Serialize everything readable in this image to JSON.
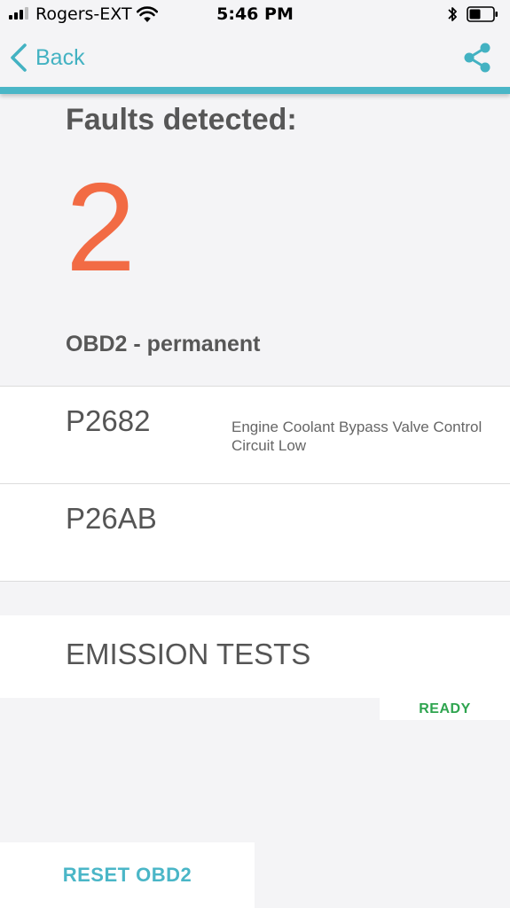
{
  "status_bar": {
    "carrier": "Rogers-EXT",
    "time": "5:46 PM",
    "signal_bars_filled": 3,
    "signal_bars_total": 4,
    "icons": [
      "signal-icon",
      "wifi-icon",
      "bluetooth-icon",
      "battery-icon"
    ]
  },
  "nav": {
    "back_label": "Back",
    "icons": [
      "chevron-left-icon",
      "share-icon"
    ]
  },
  "faults": {
    "title": "Faults detected:",
    "count": "2",
    "section_label": "OBD2 - permanent",
    "items": [
      {
        "code": "P2682",
        "description": "Engine Coolant Bypass Valve Control Circuit Low"
      },
      {
        "code": "P26AB",
        "description": ""
      }
    ]
  },
  "emission": {
    "title": "EMISSION TESTS",
    "status": "READY"
  },
  "actions": {
    "reset_label": "RESET OBD2"
  },
  "colors": {
    "accent": "#4ab6c7",
    "fault_count": "#f26b44",
    "ready": "#2ea44f",
    "background": "#f4f4f6"
  }
}
